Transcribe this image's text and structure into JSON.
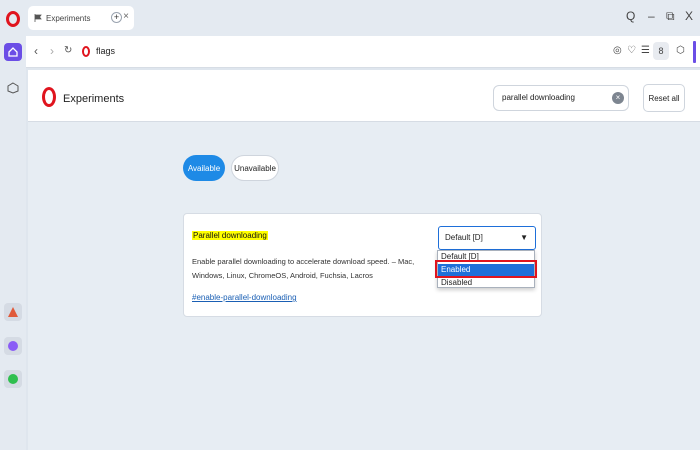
{
  "browser": {
    "tab_title": "Experiments",
    "tab_close": "×",
    "new_tab": "+",
    "url": "flags",
    "window_controls": [
      "Q",
      "–",
      "⧉",
      "X"
    ]
  },
  "page": {
    "title": "Experiments",
    "search_value": "parallel downloading",
    "reset_label": "Reset all",
    "tabs": {
      "available": "Available",
      "unavailable": "Unavailable"
    }
  },
  "flag": {
    "title": "Parallel downloading",
    "description": "Enable parallel downloading to accelerate download speed. – Mac, Windows, Linux, ChromeOS, Android, Fuchsia, Lacros",
    "link": "#enable-parallel-downloading",
    "selected_value": "Default [D]",
    "options": [
      "Default [D]",
      "Enabled",
      "Disabled"
    ]
  },
  "colors": {
    "brand": "#e0141e",
    "accent": "#1e8ae6",
    "sidebar_accent": "#6b4ee6",
    "highlight": "#ffff00"
  }
}
